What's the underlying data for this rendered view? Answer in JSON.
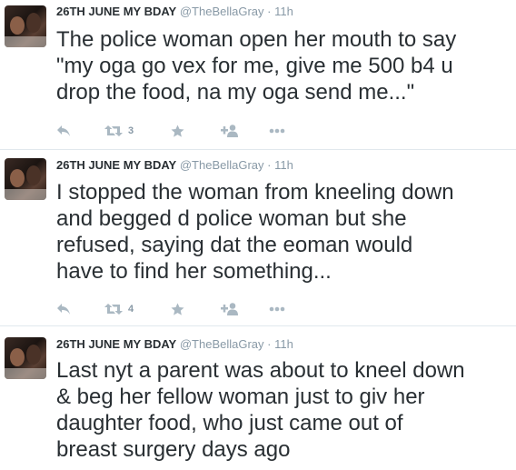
{
  "tweets": [
    {
      "name": "26TH JUNE MY BDAY",
      "handle": "@TheBellaGray",
      "separator": "·",
      "time": "11h",
      "text": "The police woman open her mouth to say\n\"my oga go vex for me, give me 500 b4 u\ndrop the food, na my oga send me...\"",
      "retweets": "3",
      "icons": [
        "reply-icon",
        "retweet-icon",
        "favorite-icon",
        "follow-icon",
        "more-icon"
      ]
    },
    {
      "name": "26TH JUNE MY BDAY",
      "handle": "@TheBellaGray",
      "separator": "·",
      "time": "11h",
      "text": "I stopped the woman from kneeling down\nand begged d police woman but she\nrefused, saying dat the eoman would\nhave to find her something...",
      "retweets": "4",
      "icons": [
        "reply-icon",
        "retweet-icon",
        "favorite-icon",
        "follow-icon",
        "more-icon"
      ]
    },
    {
      "name": "26TH JUNE MY BDAY",
      "handle": "@TheBellaGray",
      "separator": "·",
      "time": "11h",
      "text": "Last nyt a parent was about to kneel down\n& beg her fellow woman just to giv her\ndaughter food, who just came out of\nbreast surgery days ago",
      "icons": []
    }
  ],
  "colors": {
    "text": "#292f33",
    "muted": "#8899a6",
    "icon": "#aab8c2",
    "divider": "#e1e8ed"
  }
}
